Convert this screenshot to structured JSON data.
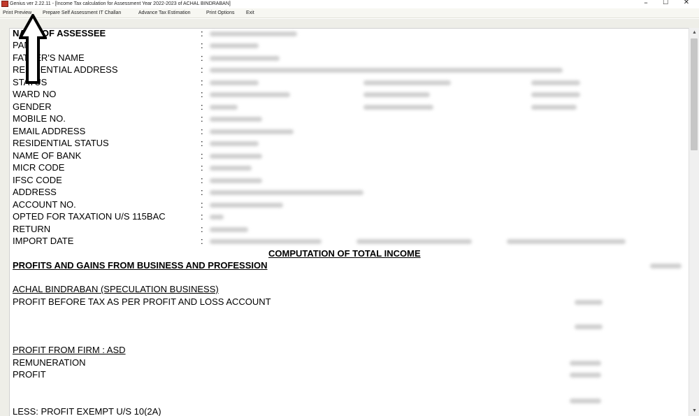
{
  "window": {
    "title": "Genius ver 2.22.11 - [Income Tax calculation for Assessment Year 2022-2023 of ACHAL BINDRABAN]",
    "minimize_glyph": "–",
    "maximize_glyph": "☐",
    "close_glyph": "✕"
  },
  "menu": {
    "items": [
      "Print Preview",
      "Prepare Self Assessment IT Challan",
      "Advance Tax Estimation",
      "Print Options",
      "Exit"
    ]
  },
  "scrollbar": {
    "up_glyph": "▲",
    "down_glyph": "▼"
  },
  "report": {
    "colon": ":",
    "fields": [
      {
        "label": "NAME OF ASSESSEE"
      },
      {
        "label": "PAN"
      },
      {
        "label": "FATHER'S NAME"
      },
      {
        "label": "RESIDENTIAL ADDRESS"
      },
      {
        "label": "STATUS"
      },
      {
        "label": "WARD NO"
      },
      {
        "label": "GENDER"
      },
      {
        "label": "MOBILE NO."
      },
      {
        "label": "EMAIL ADDRESS"
      },
      {
        "label": "RESIDENTIAL STATUS"
      },
      {
        "label": "NAME OF BANK"
      },
      {
        "label": "MICR CODE"
      },
      {
        "label": "IFSC CODE"
      },
      {
        "label": "ADDRESS"
      },
      {
        "label": "ACCOUNT NO."
      },
      {
        "label": "OPTED FOR TAXATION U/S 115BAC"
      },
      {
        "label": "RETURN"
      },
      {
        "label": "IMPORT DATE"
      }
    ],
    "computation_heading": "COMPUTATION OF TOTAL INCOME",
    "business_heading": "PROFITS AND GAINS FROM BUSINESS AND PROFESSION",
    "speculation_heading": "ACHAL BINDRABAN (SPECULATION BUSINESS)",
    "profit_before_tax": "PROFIT BEFORE TAX AS PER PROFIT AND LOSS ACCOUNT",
    "firm_heading": "PROFIT FROM FIRM : ASD",
    "remuneration": "REMUNERATION",
    "profit": "PROFIT",
    "less_exempt": "LESS: PROFIT EXEMPT U/S 10(2A)"
  },
  "colors": {
    "app_icon": "#c23a2b",
    "menubar_bg": "#f7f7f2",
    "redacted": "#cfcfcf"
  },
  "annotation": {
    "arrow_icon": "up-arrow pointing to Print Preview"
  }
}
